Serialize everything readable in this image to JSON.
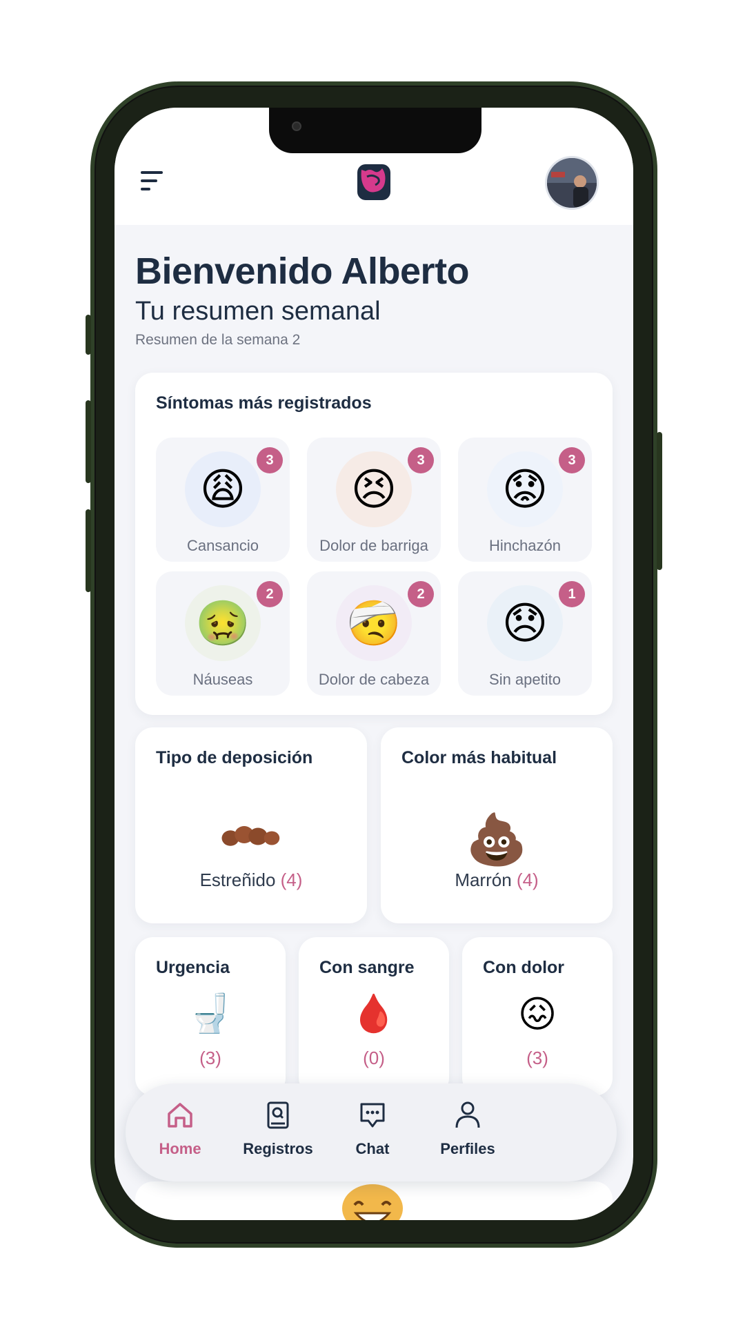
{
  "header": {
    "menu_icon": "hamburger-menu-icon",
    "logo_icon": "intestine-logo-icon",
    "avatar": "user-avatar"
  },
  "greeting": {
    "title": "Bienvenido Alberto",
    "subtitle": "Tu resumen semanal",
    "week": "Resumen de la semana 2"
  },
  "symptoms": {
    "title": "Síntomas más registrados",
    "items": [
      {
        "label": "Cansancio",
        "count": "3",
        "icon": "tired-boy-icon"
      },
      {
        "label": "Dolor de barriga",
        "count": "3",
        "icon": "stomach-ache-girl-icon"
      },
      {
        "label": "Hinchazón",
        "count": "3",
        "icon": "bloating-boy-icon"
      },
      {
        "label": "Náuseas",
        "count": "2",
        "icon": "nausea-boy-icon"
      },
      {
        "label": "Dolor de cabeza",
        "count": "2",
        "icon": "headache-girl-icon"
      },
      {
        "label": "Sin apetito",
        "count": "1",
        "icon": "no-appetite-boy-icon"
      }
    ]
  },
  "deposition": {
    "type_title": "Tipo de deposición",
    "type_value": "Estreñido",
    "type_count": "(4)",
    "color_title": "Color más habitual",
    "color_value": "Marrón",
    "color_count": "(4)"
  },
  "flags": [
    {
      "title": "Urgencia",
      "count": "(3)",
      "icon": "urgency-toilet-icon"
    },
    {
      "title": "Con sangre",
      "count": "(0)",
      "icon": "blood-icon"
    },
    {
      "title": "Con dolor",
      "count": "(3)",
      "icon": "pain-icon"
    }
  ],
  "nav": {
    "home": "Home",
    "records": "Registros",
    "chat": "Chat",
    "profiles": "Perfiles"
  },
  "colors": {
    "accent": "#c55f88",
    "text_dark": "#1e2d42",
    "background": "#f4f5f9"
  }
}
